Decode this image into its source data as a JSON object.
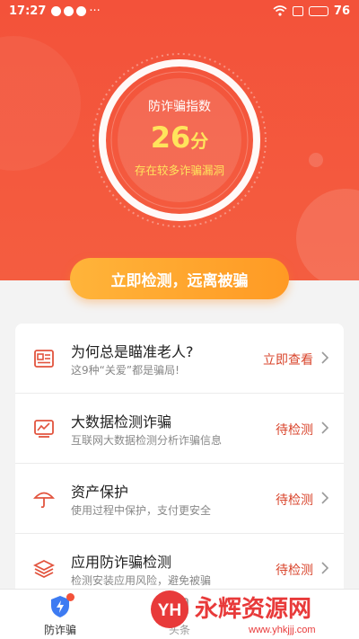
{
  "status_bar": {
    "time": "17:27",
    "battery": "76",
    "more": "···"
  },
  "hero": {
    "gauge_label": "防诈骗指数",
    "score": "26",
    "score_unit": "分",
    "score_note": "存在较多诈骗漏洞",
    "cta": "立即检测，远离被骗"
  },
  "items": [
    {
      "icon": "news-icon",
      "title": "为何总是瞄准老人?",
      "desc": "这9种“关爱”都是骗局!",
      "action": "立即查看"
    },
    {
      "icon": "chart-icon",
      "title": "大数据检测诈骗",
      "desc": "互联网大数据检测分析诈骗信息",
      "action": "待检测"
    },
    {
      "icon": "umbrella-icon",
      "title": "资产保护",
      "desc": "使用过程中保护，支付更安全",
      "action": "待检测"
    },
    {
      "icon": "layers-icon",
      "title": "应用防诈骗检测",
      "desc": "检测安装应用风险，避免被骗",
      "action": "待检测"
    }
  ],
  "tabbar": {
    "tabs": [
      {
        "label": "防诈骗",
        "icon": "shield-icon"
      },
      {
        "label": "头条",
        "icon": "news-tab-icon"
      }
    ]
  },
  "watermark": {
    "logo": "YH",
    "text": "永辉资源网",
    "url": "www.yhkjjj.com"
  },
  "colors": {
    "accent": "#f3523a",
    "cta": "#ff9a24",
    "score": "#ffe45c",
    "action": "#d9452c"
  }
}
